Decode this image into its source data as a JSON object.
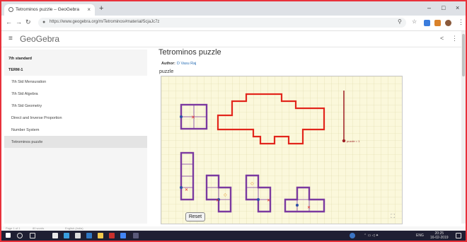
{
  "browser": {
    "tab_title": "Tetrominos puzzle – GeoGebra",
    "tab_close": "×",
    "new_tab": "+",
    "url": "https://www.geogebra.org/m/Tetrominos#material/5cjaJc7z",
    "min": "–",
    "max": "□",
    "close": "×"
  },
  "app": {
    "brand": "GeoGebra",
    "share_icon": "share-icon",
    "menu_icon": "more-vert-icon"
  },
  "sidebar": {
    "items": [
      {
        "label": "7th standard",
        "type": "bold"
      },
      {
        "label": "TERM-1",
        "type": "bold"
      },
      {
        "label": "7th Std Mensuration",
        "type": "sub"
      },
      {
        "label": "7th Std Algebra",
        "type": "sub"
      },
      {
        "label": "7th Std Geometry",
        "type": "sub"
      },
      {
        "label": "Direct and Inverse Proportion",
        "type": "sub"
      },
      {
        "label": "Number System",
        "type": "sub"
      },
      {
        "label": "Tetrominos puzzle",
        "type": "active"
      }
    ]
  },
  "main": {
    "title": "Tetrominos puzzle",
    "author_label": "Author:",
    "author": "D Vasu Raj",
    "description": "puzzle",
    "reset_label": "Reset",
    "fullscreen_icon": "fullscreen-icon",
    "slider_label": "puzzle = 1",
    "puzzle_value": 1
  },
  "colors": {
    "tile": "#7b3aa0",
    "outline": "#e2261c",
    "grid_bg": "#fbf8db",
    "grid_line": "#dcd8a5",
    "taskbar": "#1f1f33"
  },
  "statusbar": {
    "page": "Page 1 of 1",
    "words": "80 words",
    "lang": "English (India)"
  },
  "taskbar": {
    "lang": "ENG",
    "time": "20:25",
    "date": "16-02-2019"
  }
}
